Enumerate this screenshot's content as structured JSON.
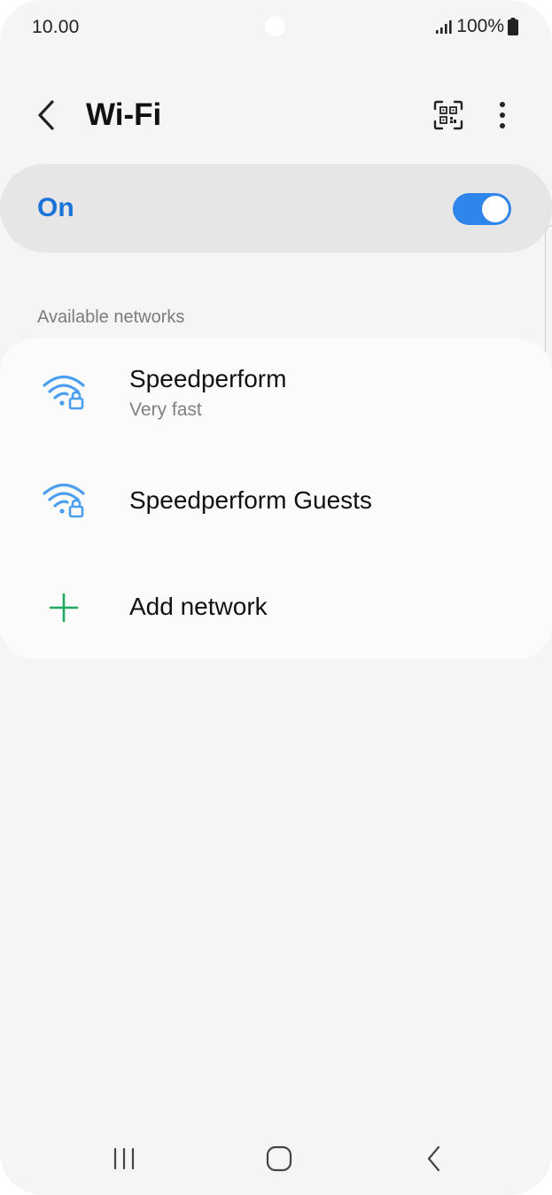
{
  "status_bar": {
    "time": "10.00",
    "battery": "100%",
    "icons": [
      "signal-icon",
      "battery-icon"
    ]
  },
  "app_bar": {
    "title": "Wi-Fi",
    "icons": [
      "back-chevron-icon",
      "qr-code-scan-icon",
      "more-options-icon"
    ]
  },
  "master_switch": {
    "label": "On",
    "enabled": true
  },
  "section": {
    "header": "Available networks"
  },
  "networks": [
    {
      "name": "Speedperform",
      "status": "Very fast",
      "icon": "wifi-lock-icon"
    },
    {
      "name": "Speedperform Guests",
      "status": "",
      "icon": "wifi-lock-icon"
    }
  ],
  "add_network": {
    "label": "Add network",
    "icon": "plus-icon"
  },
  "nav_bar": {
    "icons": [
      "recent-apps-icon",
      "home-icon",
      "back-icon"
    ]
  },
  "colors": {
    "accent": "#1a73d9",
    "toggle": "#2f86ea",
    "wifi_icon": "#4a9ff0",
    "plus_icon": "#1fab5e",
    "background": "#f5f5f5",
    "card": "#fbfbfb",
    "switch_row": "#e6e6e6"
  }
}
